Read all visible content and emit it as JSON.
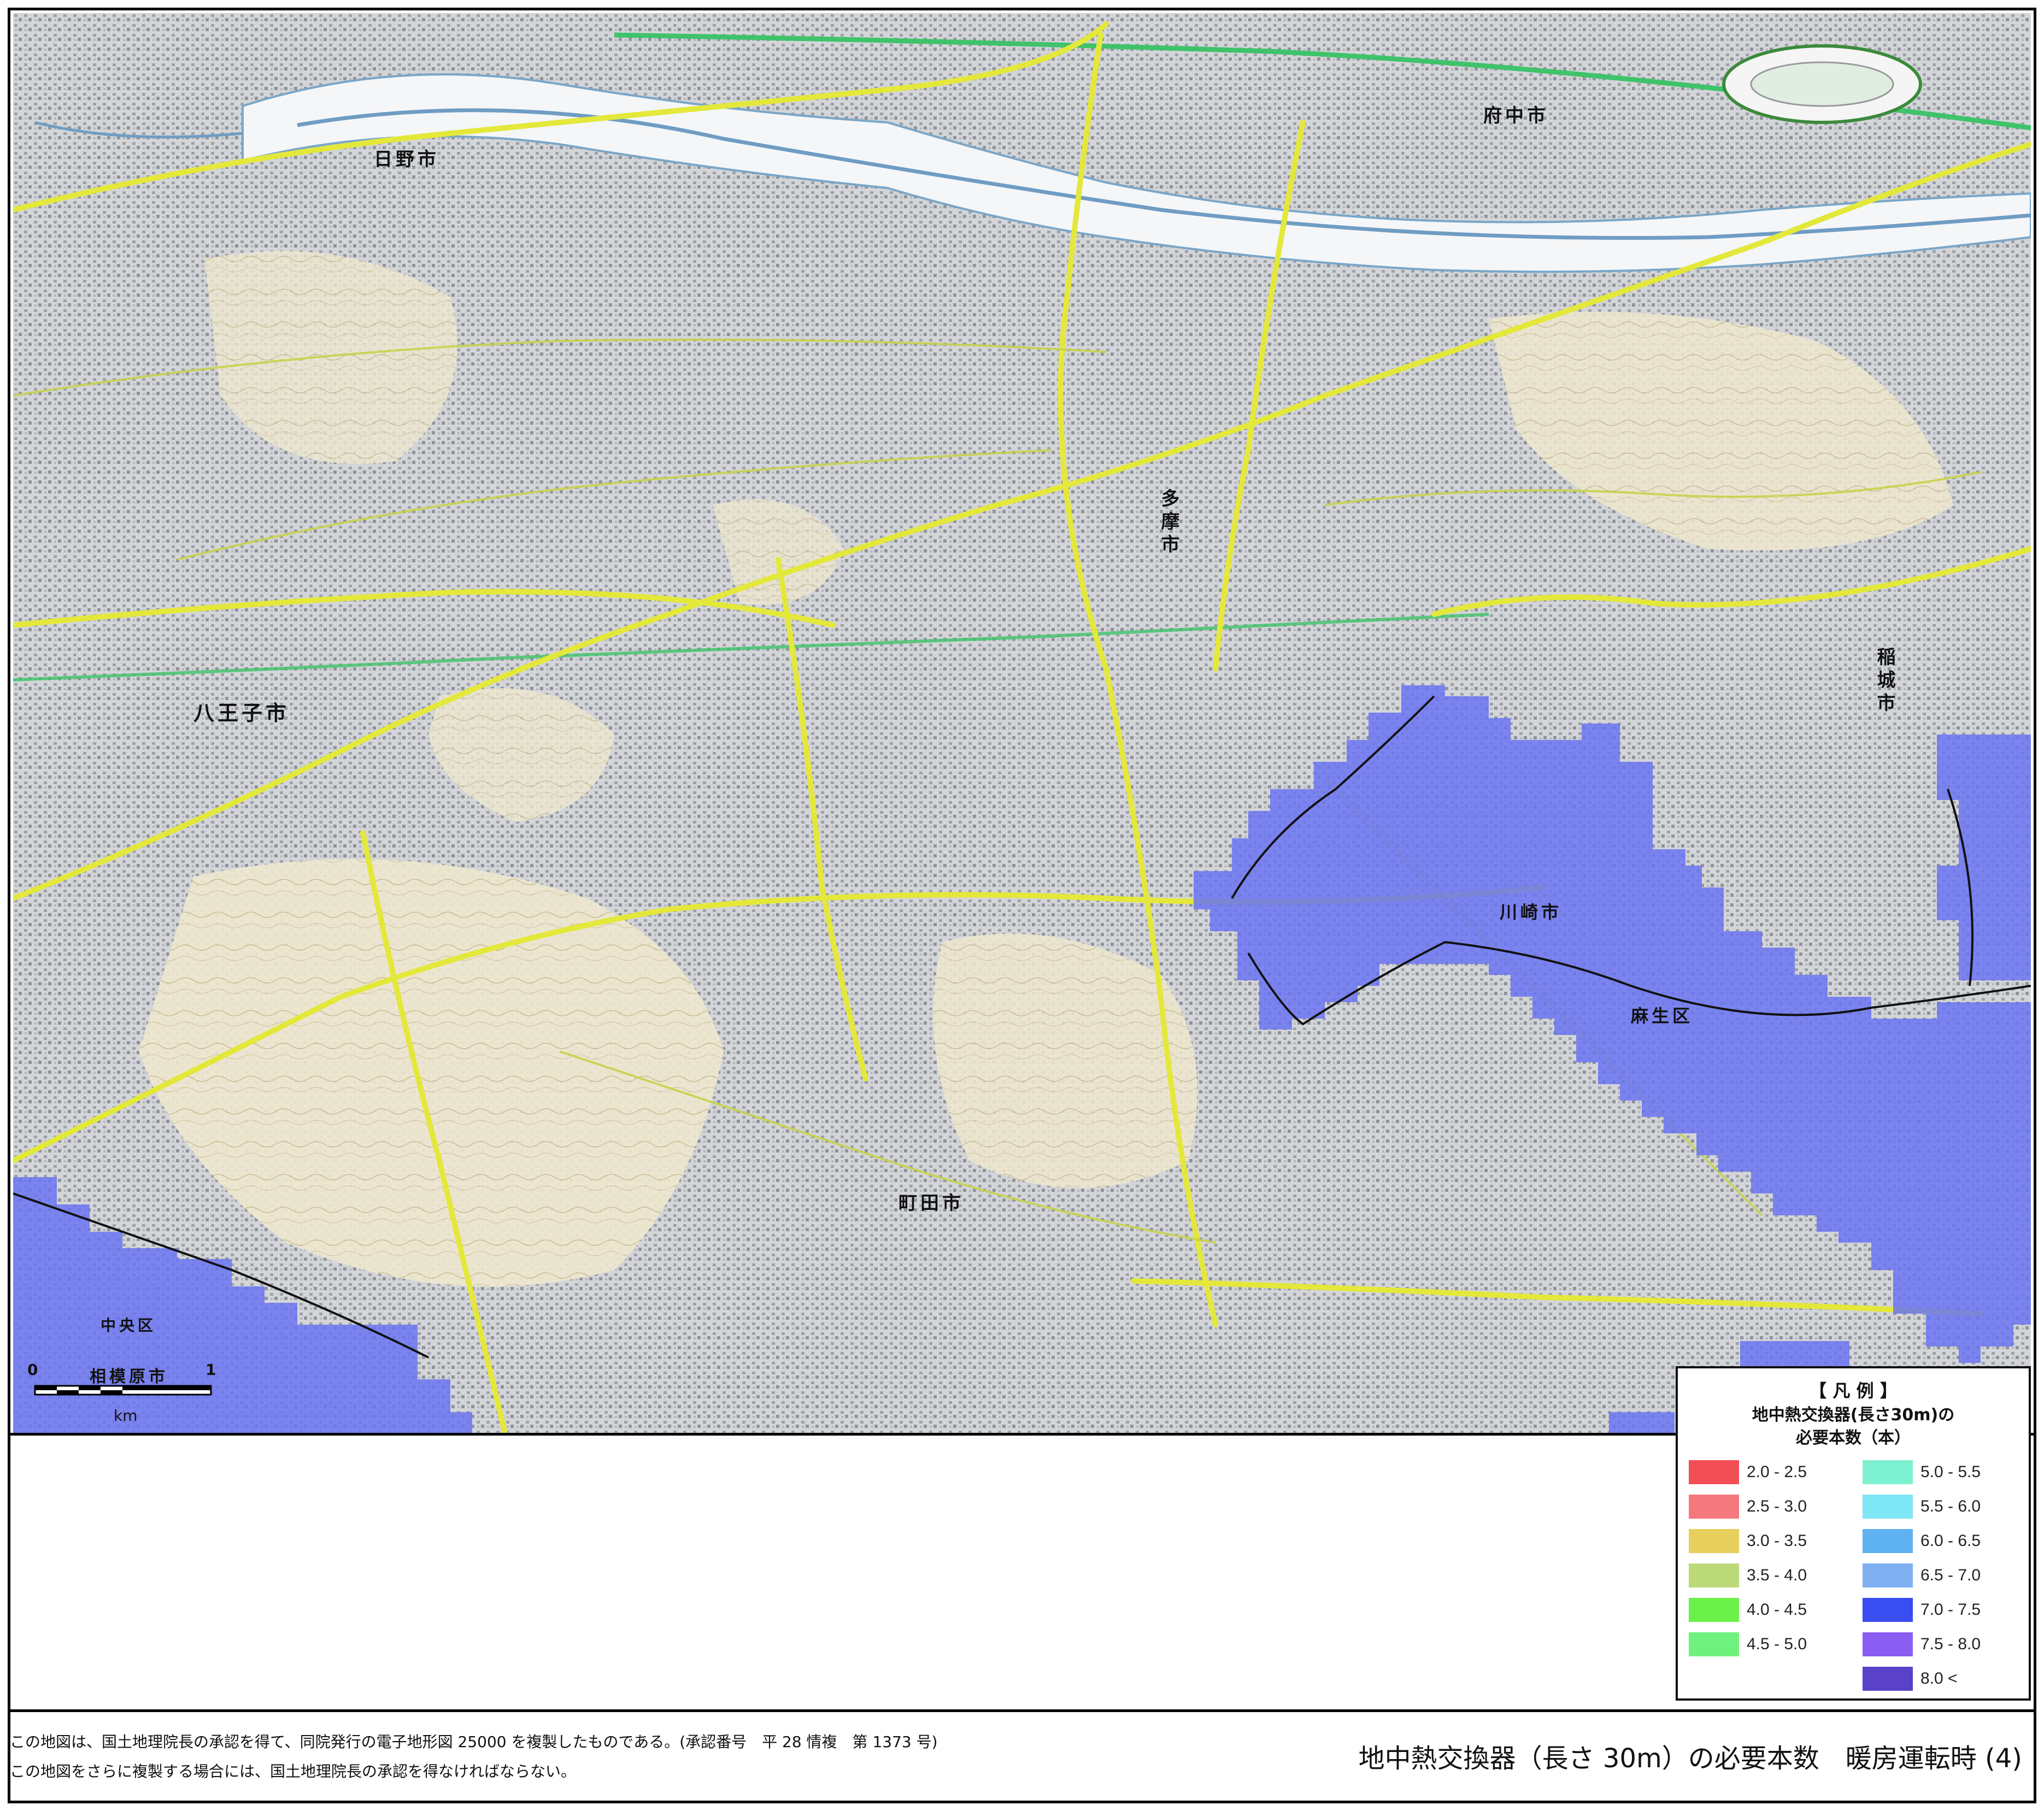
{
  "map": {
    "places": {
      "hino": "日野市",
      "fuchu": "府中市",
      "tama": "多摩市",
      "hachioji": "八王子市",
      "machida": "町田市",
      "kawasaki": "川崎市",
      "asao": "麻生区",
      "inagi": "稲城市",
      "chuo": "中央区",
      "sagamihara": "相模原市"
    },
    "colors": {
      "overlay_blue": "#6a74f2",
      "road_yellow": "#e3e83a",
      "rail_green": "#3fc36a",
      "river_white": "#f4f6f8",
      "terrain_beige": "#efe8cf",
      "urban_gray": "#c9ccd0"
    }
  },
  "scale": {
    "start": "0",
    "end": "1",
    "unit": "km"
  },
  "legend": {
    "title": "【 凡 例 】",
    "subtitle1": "地中熱交換器(長さ30m)の",
    "subtitle2": "必要本数（本）",
    "left_items": [
      {
        "label": "2.0 - 2.5",
        "color": "#f24e55"
      },
      {
        "label": "2.5 - 3.0",
        "color": "#f5787e"
      },
      {
        "label": "3.0 - 3.5",
        "color": "#e6cf5c"
      },
      {
        "label": "3.5 - 4.0",
        "color": "#bcd97a"
      },
      {
        "label": "4.0 - 4.5",
        "color": "#6cf04a"
      },
      {
        "label": "4.5 - 5.0",
        "color": "#6ff27d"
      }
    ],
    "right_items": [
      {
        "label": "5.0 - 5.5",
        "color": "#7ef2d0"
      },
      {
        "label": "5.5 - 6.0",
        "color": "#7fe6f5"
      },
      {
        "label": "6.0 - 6.5",
        "color": "#5fb2f2"
      },
      {
        "label": "6.5 - 7.0",
        "color": "#7fb0f2"
      },
      {
        "label": "7.0 - 7.5",
        "color": "#3a4df0"
      },
      {
        "label": "7.5 - 8.0",
        "color": "#8a5ef2"
      },
      {
        "label": "8.0 <",
        "color": "#5a42c8"
      }
    ]
  },
  "footer": {
    "copyright1": "この地図は、国土地理院長の承認を得て、同院発行の電子地形図 25000 を複製したものである。(承認番号　平 28 情複　第 1373 号)",
    "copyright2": "この地図をさらに複製する場合には、国土地理院長の承認を得なければならない。",
    "title": "地中熱交換器（長さ 30m）の必要本数　暖房運転時 (4)"
  }
}
